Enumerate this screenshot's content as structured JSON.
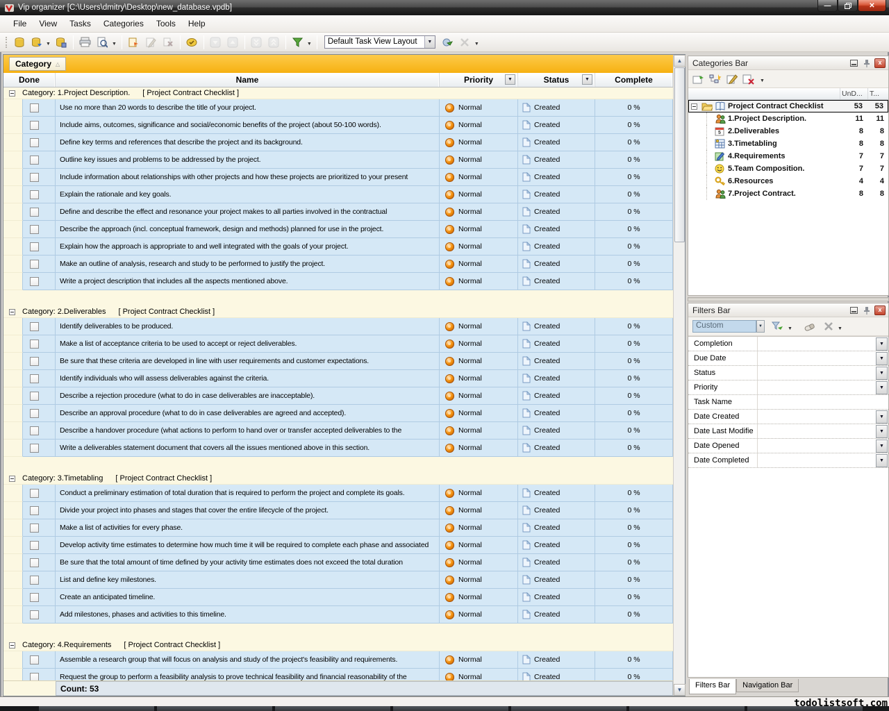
{
  "window": {
    "title": "Vip organizer [C:\\Users\\dmitry\\Desktop\\new_database.vpdb]"
  },
  "menu": [
    "File",
    "View",
    "Tasks",
    "Categories",
    "Tools",
    "Help"
  ],
  "toolbar": {
    "layout_combo": "Default Task View Layout"
  },
  "grid": {
    "group_by": "Category",
    "columns": {
      "done": "Done",
      "name": "Name",
      "priority": "Priority",
      "status": "Status",
      "complete": "Complete"
    },
    "priority_value": "Normal",
    "status_value": "Created",
    "complete_value": "0 %",
    "count_label": "Count: 53",
    "groups": [
      {
        "label": "Category: 1.Project Description.",
        "tag": "[ Project Contract Checklist ]",
        "tasks": [
          "Use no more than 20 words to describe the title of your project.",
          "Include aims, outcomes, significance and social/economic benefits of the project (about 50-100 words).",
          "Define key terms and references that describe the project and its background.",
          "Outline key issues and problems to be addressed by the project.",
          "Include information about relationships with other projects and how these projects are prioritized to your present",
          "Explain the rationale and key goals.",
          "Define and describe the effect and resonance your project makes to all parties involved in the contractual",
          "Describe the approach (incl. conceptual framework, design and methods) planned for use in the project.",
          "Explain how the approach is appropriate to and well integrated with the goals of your project.",
          "Make an outline of analysis, research and study to be performed to justify the project.",
          "Write a project description that includes all the aspects mentioned above."
        ]
      },
      {
        "label": "Category: 2.Deliverables",
        "tag": "[ Project Contract Checklist ]",
        "tasks": [
          "Identify deliverables to be produced.",
          "Make a list of acceptance criteria to be used to accept or reject deliverables.",
          "Be sure that these criteria are developed in line with user requirements and customer expectations.",
          "Identify individuals who will assess deliverables against the criteria.",
          "Describe a rejection procedure (what to do in case deliverables are inacceptable).",
          "Describe an approval procedure (what to do in case deliverables are agreed and accepted).",
          "Describe a handover procedure (what actions to perform to hand over or transfer accepted deliverables to the",
          "Write a deliverables statement document that covers all the issues mentioned above in this section."
        ]
      },
      {
        "label": "Category: 3.Timetabling",
        "tag": "[ Project Contract Checklist ]",
        "tasks": [
          "Conduct a preliminary estimation of total duration that is required to perform the project and complete its goals.",
          "Divide your project into phases and stages that cover the entire lifecycle of the project.",
          "Make a list of activities for every phase.",
          "Develop activity time estimates to determine how much time it will be required to complete each phase and associated",
          "Be sure that the total amount of time defined by your activity time estimates does not exceed the total duration",
          "List and define key milestones.",
          "Create an anticipated timeline.",
          "Add milestones, phases and activities to this timeline."
        ]
      },
      {
        "label": "Category: 4.Requirements",
        "tag": "[ Project Contract Checklist ]",
        "tasks": [
          "Assemble a research group that will focus on analysis and study of the project's feasibility and requirements.",
          "Request the group to perform a feasibility analysis to prove technical feasibility and financial reasonability of the"
        ]
      }
    ]
  },
  "categories_bar": {
    "title": "Categories Bar",
    "columns": [
      "UnD...",
      "T..."
    ],
    "root": {
      "label": "Project Contract Checklist",
      "undone": "53",
      "total": "53"
    },
    "items": [
      {
        "label": "1.Project Description.",
        "undone": "11",
        "total": "11",
        "icon": "people"
      },
      {
        "label": "2.Deliverables",
        "undone": "8",
        "total": "8",
        "icon": "calendar"
      },
      {
        "label": "3.Timetabling",
        "undone": "8",
        "total": "8",
        "icon": "schedule"
      },
      {
        "label": "4.Requirements",
        "undone": "7",
        "total": "7",
        "icon": "notes"
      },
      {
        "label": "5.Team Composition.",
        "undone": "7",
        "total": "7",
        "icon": "smiley"
      },
      {
        "label": "6.Resources",
        "undone": "4",
        "total": "4",
        "icon": "key"
      },
      {
        "label": "7.Project Contract.",
        "undone": "8",
        "total": "8",
        "icon": "people"
      }
    ]
  },
  "filters_bar": {
    "title": "Filters Bar",
    "preset": "Custom",
    "fields": [
      {
        "label": "Completion",
        "has_dropdown": true
      },
      {
        "label": "Due Date",
        "has_dropdown": true
      },
      {
        "label": "Status",
        "has_dropdown": true
      },
      {
        "label": "Priority",
        "has_dropdown": true
      },
      {
        "label": "Task Name",
        "has_dropdown": false
      },
      {
        "label": "Date Created",
        "has_dropdown": true
      },
      {
        "label": "Date Last Modifie",
        "has_dropdown": true
      },
      {
        "label": "Date Opened",
        "has_dropdown": true
      },
      {
        "label": "Date Completed",
        "has_dropdown": true
      }
    ]
  },
  "bottom_tabs": [
    "Filters Bar",
    "Navigation Bar"
  ],
  "watermark": "todolistsoft.com"
}
